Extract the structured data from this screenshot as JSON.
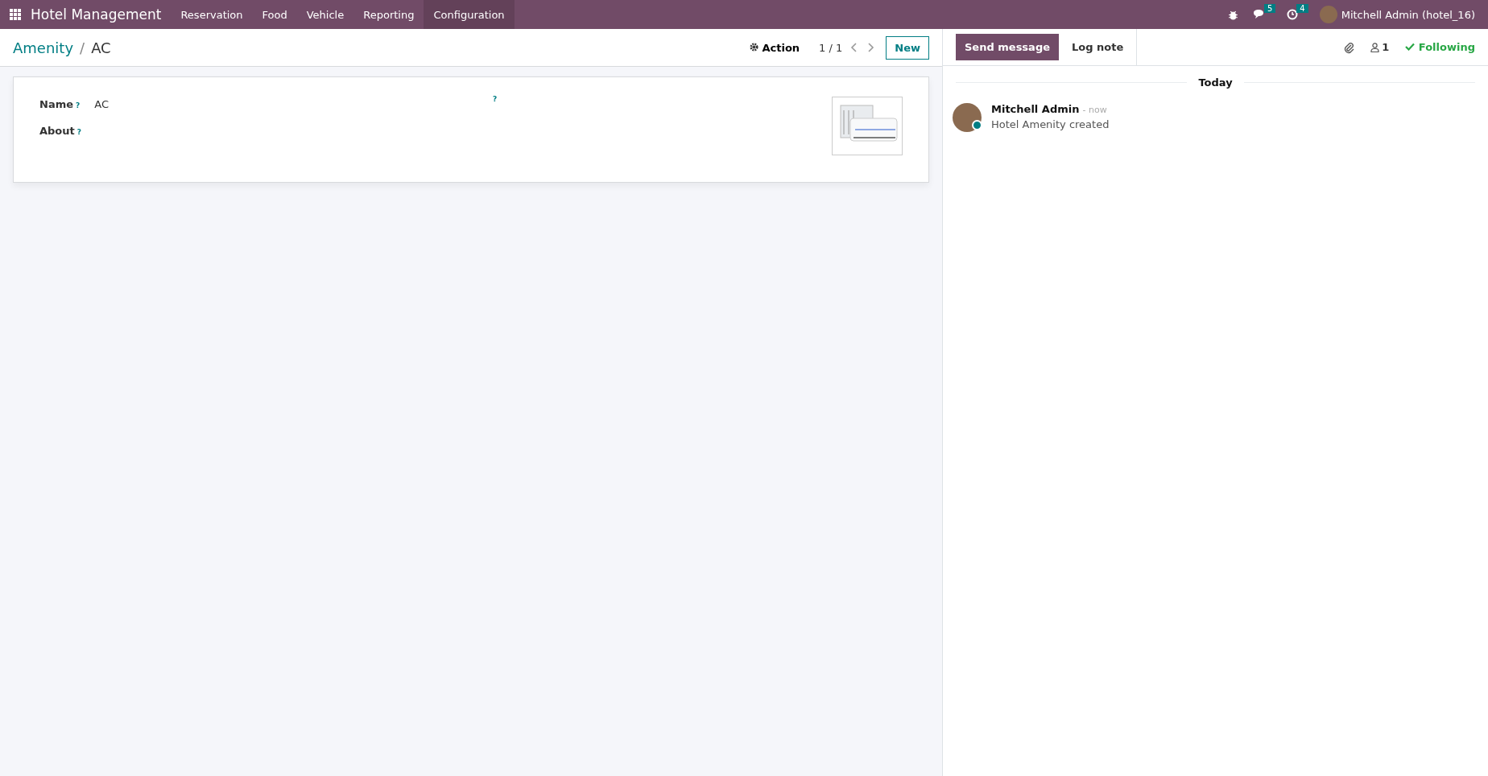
{
  "navbar": {
    "app_name": "Hotel Management",
    "menu": [
      {
        "label": "Reservation",
        "selected": false
      },
      {
        "label": "Food",
        "selected": false
      },
      {
        "label": "Vehicle",
        "selected": false
      },
      {
        "label": "Reporting",
        "selected": false
      },
      {
        "label": "Configuration",
        "selected": true
      }
    ],
    "messages_count": "5",
    "activities_count": "4",
    "user": "Mitchell Admin (hotel_16)"
  },
  "breadcrumb": {
    "parent": "Amenity",
    "separator": "/",
    "current": "AC"
  },
  "control": {
    "action": "Action",
    "pager": "1 / 1",
    "new": "New"
  },
  "form": {
    "fields": [
      {
        "label": "Name",
        "help": "?",
        "value": "AC"
      },
      {
        "label": "About",
        "help": "?"
      }
    ],
    "extra_help": "?"
  },
  "chatter": {
    "send_message": "Send message",
    "log_note": "Log note",
    "followers": "1",
    "following": "Following",
    "date_separator": "Today",
    "messages": [
      {
        "author": "Mitchell Admin",
        "time": "- now",
        "body": "Hotel Amenity created",
        "online": true
      }
    ]
  }
}
